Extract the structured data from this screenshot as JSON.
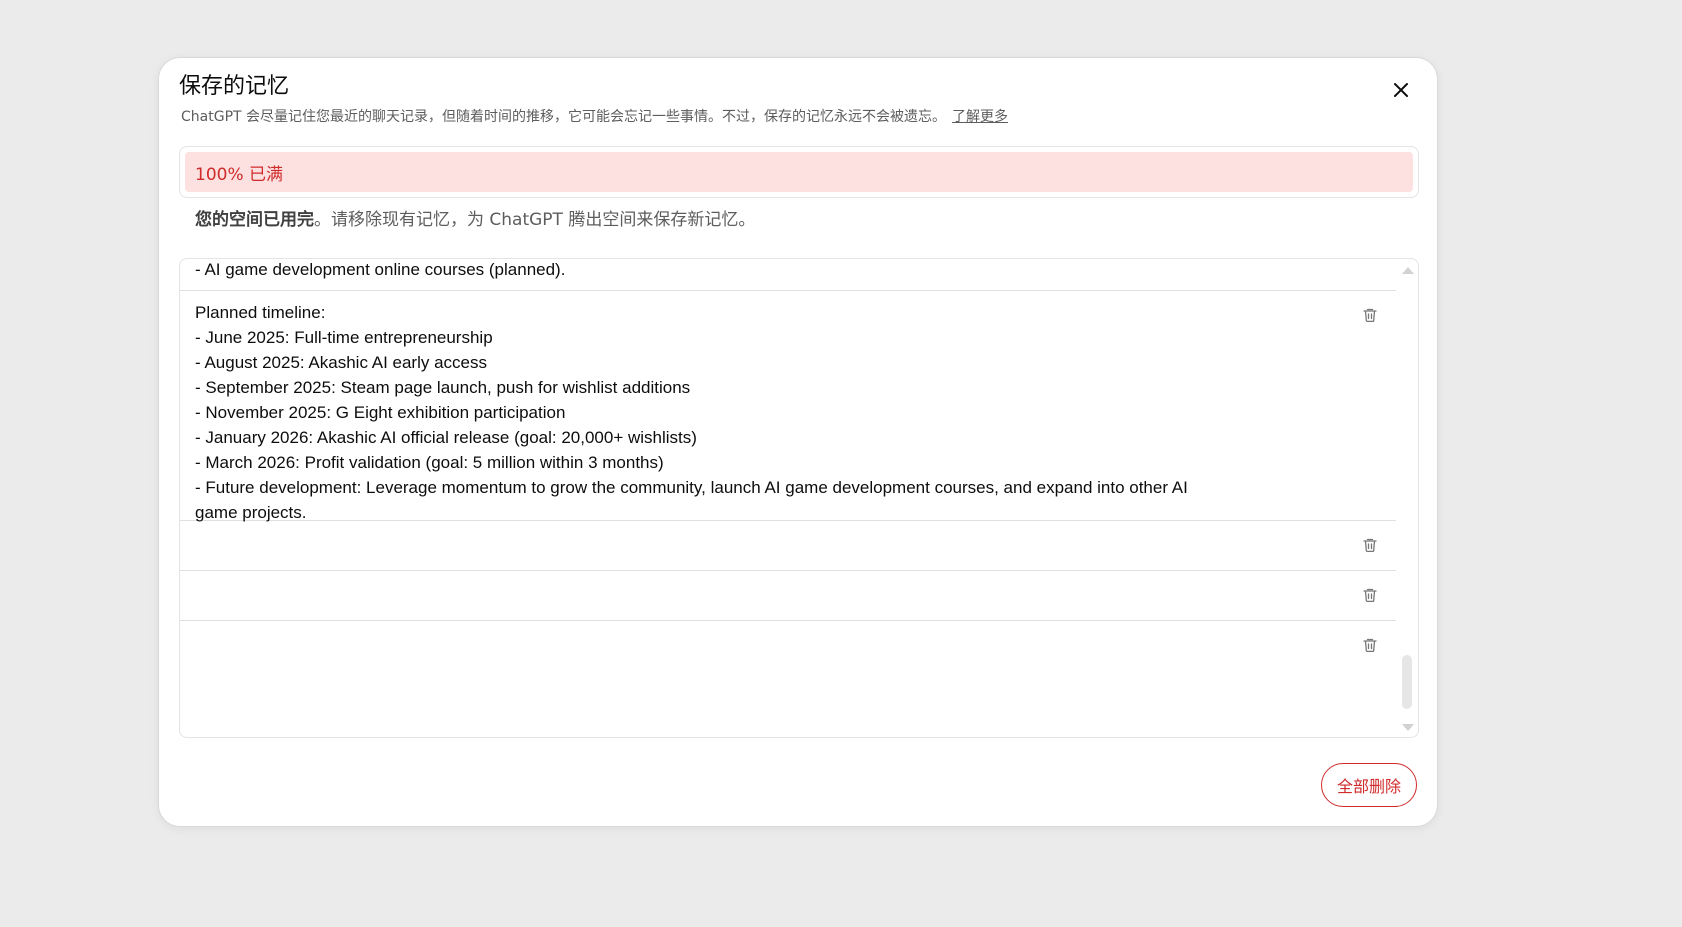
{
  "dialog": {
    "title": "保存的记忆",
    "subtitle": "ChatGPT 会尽量记住您最近的聊天记录，但随着时间的推移，它可能会忘记一些事情。不过，保存的记忆永远不会被遗忘。",
    "learn_more": "了解更多",
    "close_icon": "close-icon"
  },
  "usage": {
    "label": "100% 已满",
    "percent": 100
  },
  "full_note": {
    "bold": "您的空间已用完",
    "rest": "。请移除现有记忆，为 ChatGPT 腾出空间来保存新记忆。"
  },
  "memories": [
    {
      "lines": [
        "- AI game development online courses (planned)."
      ]
    },
    {
      "lines": [
        "Planned timeline:",
        "- June 2025: Full-time entrepreneurship",
        "- August 2025: Akashic AI early access",
        "- September 2025: Steam page launch, push for wishlist additions",
        "- November 2025: G Eight exhibition participation",
        "- January 2026: Akashic AI official release (goal: 20,000+ wishlists)",
        "- March 2026: Profit validation (goal: 5 million within 3 months)",
        "- Future development: Leverage momentum to grow the community, launch AI game development courses, and expand into other AI",
        "game projects."
      ]
    },
    {
      "lines": []
    },
    {
      "lines": []
    },
    {
      "lines": []
    }
  ],
  "footer": {
    "delete_all": "全部删除"
  },
  "colors": {
    "danger": "#d02b2b",
    "usage_bg": "#fde1e1"
  }
}
